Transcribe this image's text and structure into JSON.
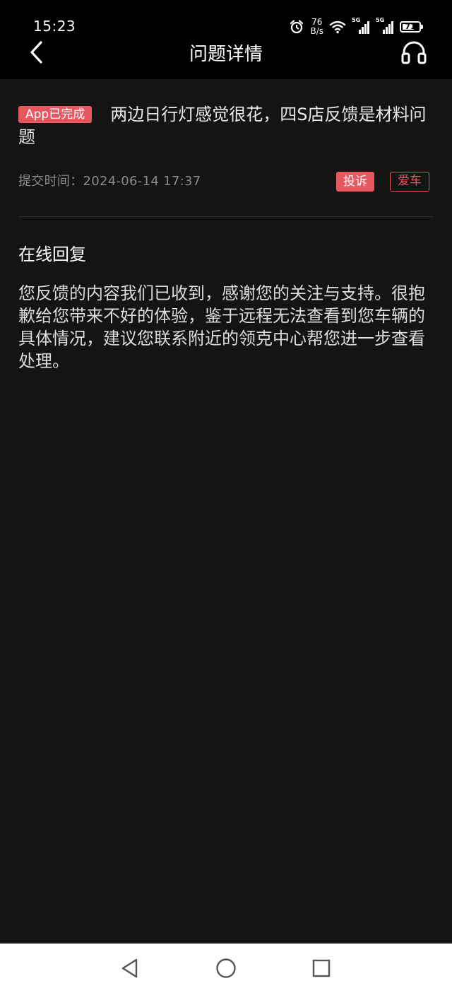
{
  "status_bar": {
    "time": "15:23",
    "net_speed_value": "76",
    "net_speed_unit": "B/s",
    "sim1_tag": "5G",
    "sim2_tag": "5G",
    "battery_level": "71"
  },
  "header": {
    "title": "问题详情"
  },
  "question": {
    "status": "App已完成",
    "text": "两边日行灯感觉很花，四S店反馈是材料问题",
    "submit_time": "提交时间：2024-06-14 17:37",
    "tags": [
      "投诉",
      "爱车"
    ]
  },
  "reply": {
    "heading": "在线回复",
    "body": "您反馈的内容我们已收到，感谢您的关注与支持。很抱歉给您带来不好的体验，鉴于远程无法查看到您车辆的具体情况，建议您联系附近的领克中心帮您进一步查看处理。"
  },
  "colors": {
    "accent": "#e85660",
    "background": "#141414",
    "header_bg": "#000000"
  },
  "icons": {
    "back": "chevron-left-icon",
    "service": "headset-icon",
    "alarm": "alarm-clock-icon",
    "wifi": "wifi-icon",
    "nav_back": "triangle-back-icon",
    "nav_home": "circle-home-icon",
    "nav_recents": "square-recents-icon"
  }
}
